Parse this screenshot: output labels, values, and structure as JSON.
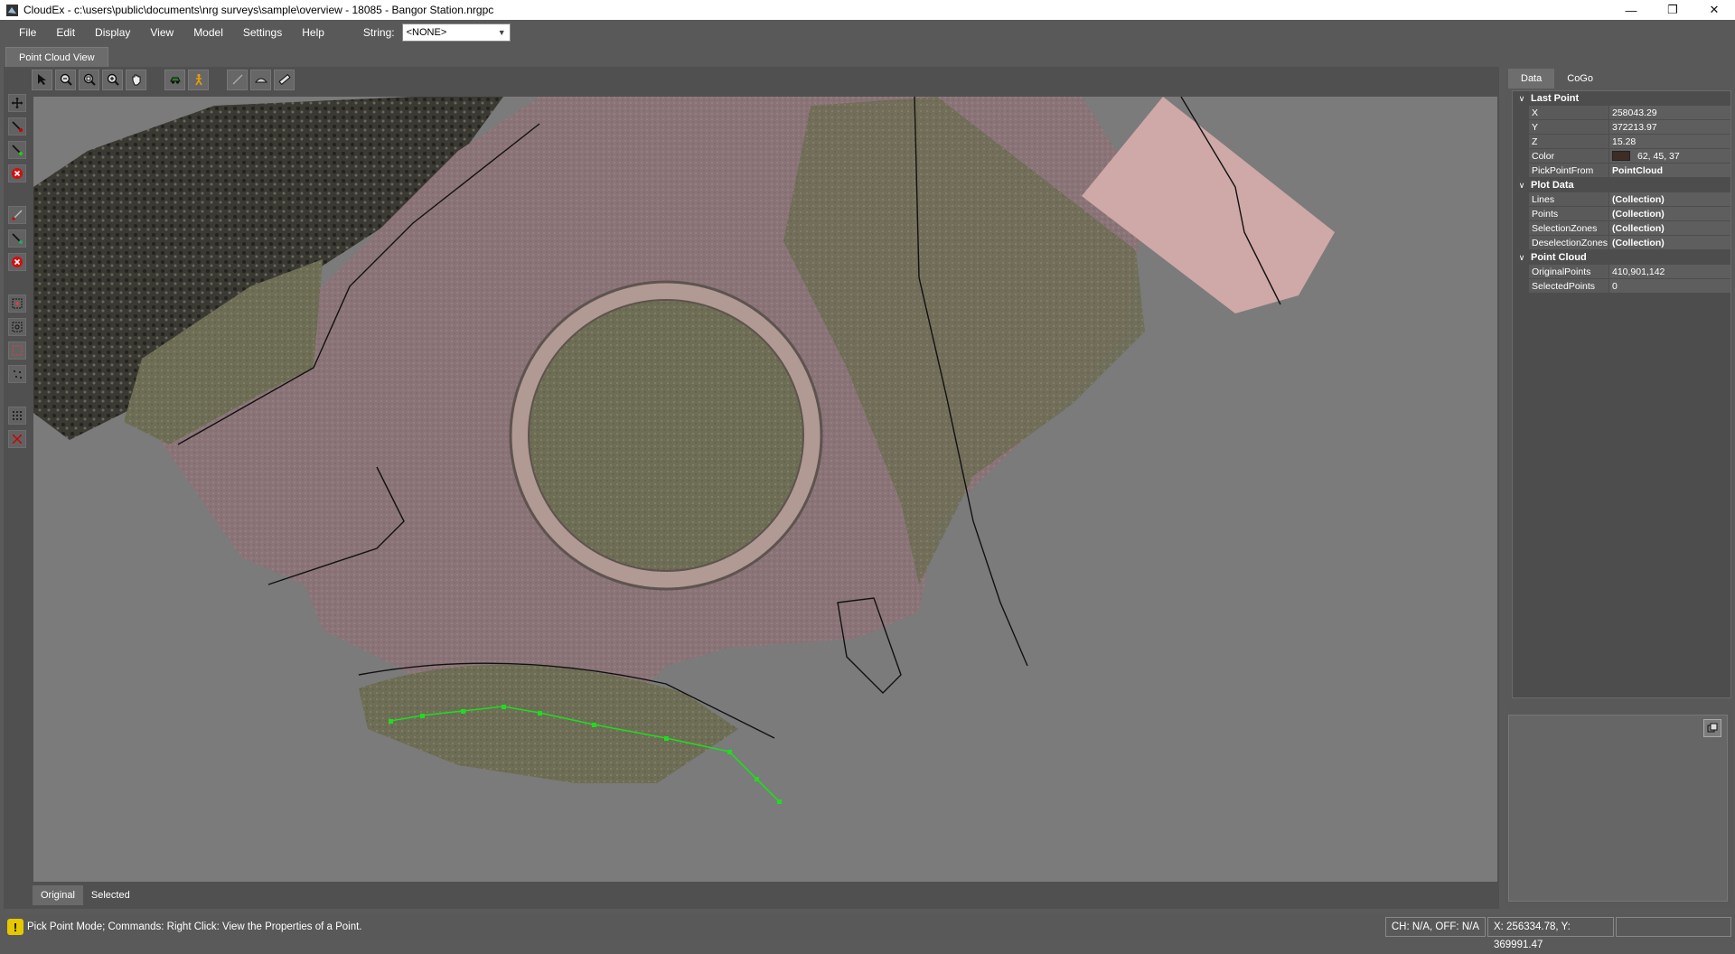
{
  "window": {
    "title": "CloudEx - c:\\users\\public\\documents\\nrg surveys\\sample\\overview - 18085 - Bangor Station.nrgpc",
    "controls": [
      "minimize-icon",
      "restore-icon",
      "close-icon"
    ]
  },
  "menu": {
    "items": [
      "File",
      "Edit",
      "Display",
      "View",
      "Model",
      "Settings",
      "Help"
    ],
    "string_label": "String:",
    "string_value": "<NONE>"
  },
  "doc_tab": "Point Cloud View",
  "toolbar_icons": [
    "select-arrow-icon",
    "zoom-out-icon",
    "zoom-extents-icon",
    "zoom-in-icon",
    "pan-hand-icon",
    "orbit-icon",
    "walk-person-icon",
    "line-tool-icon",
    "surface-tool-icon",
    "measure-tool-icon"
  ],
  "side_icons": [
    "move-icon",
    "pick-line-icon",
    "pick-point-icon",
    "delete-icon",
    "draw-line-icon",
    "add-node-icon",
    "delete-line-icon",
    "select-zone-icon",
    "deselect-zone-icon",
    "clear-zone-icon",
    "point-select-icon",
    "grid-points-icon",
    "clear-points-icon"
  ],
  "bottom_tabs": [
    "Original",
    "Selected"
  ],
  "right_tabs": [
    "Data",
    "CoGo"
  ],
  "properties": {
    "last_point": {
      "label": "Last Point",
      "x_key": "X",
      "x": "258043.29",
      "y_key": "Y",
      "y": "372213.97",
      "z_key": "Z",
      "z": "15.28",
      "color_key": "Color",
      "color": "62, 45, 37",
      "color_hex": "#3e2d25",
      "pick_key": "PickPointFrom",
      "pick": "PointCloud"
    },
    "plot_data": {
      "label": "Plot Data",
      "lines_key": "Lines",
      "lines": "(Collection)",
      "points_key": "Points",
      "points": "(Collection)",
      "sel_key": "SelectionZones",
      "sel": "(Collection)",
      "desel_key": "DeselectionZones",
      "desel": "(Collection)"
    },
    "point_cloud": {
      "label": "Point Cloud",
      "orig_key": "OriginalPoints",
      "orig": "410,901,142",
      "selected_key": "SelectedPoints",
      "selected": "0"
    }
  },
  "status": {
    "message": "Pick Point Mode; Commands: Right Click: View the Properties of a Point.",
    "ch": "CH: N/A, OFF: N/A",
    "coords": "X: 256334.78, Y: 369991.47"
  },
  "colors": {
    "background": "#7b7b7b",
    "pavement": "#8a7478",
    "grass": "#6e6d55",
    "selected_line": "#1fdc1f"
  }
}
